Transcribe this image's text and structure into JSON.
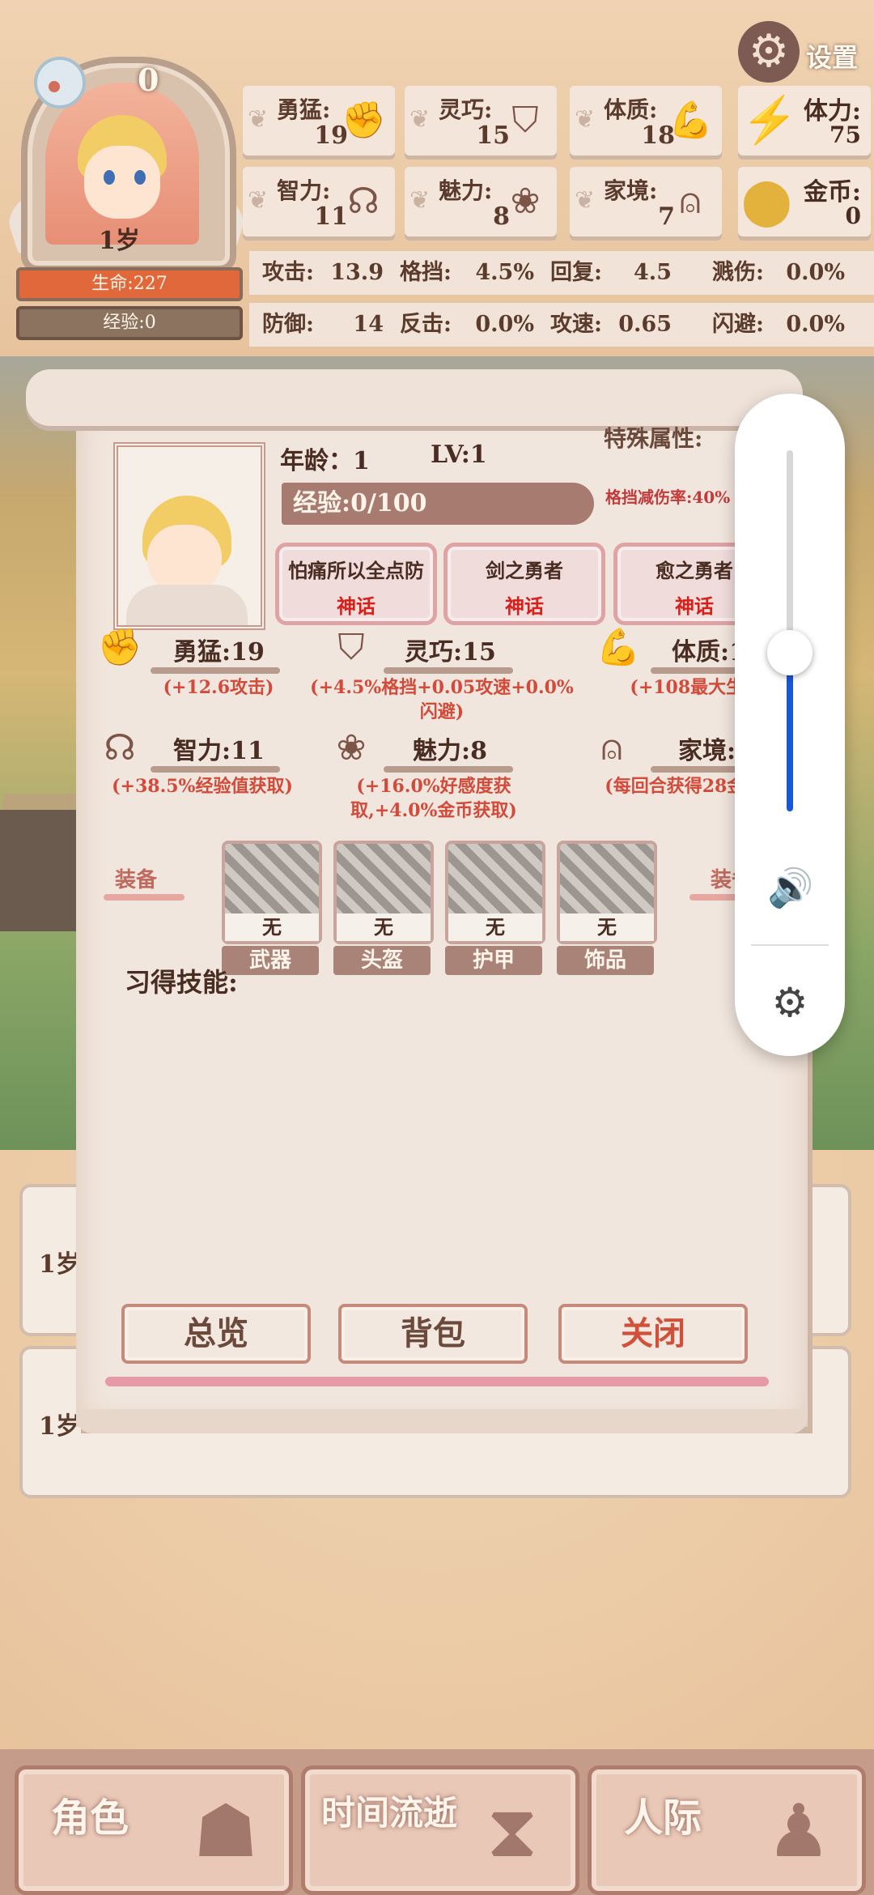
{
  "header": {
    "souls_count": "0",
    "age_badge": "1岁",
    "hp_bar": "生命:227",
    "exp_bar": "经验:0",
    "settings_label": "设置"
  },
  "primary_stats": [
    {
      "label": "勇猛:",
      "value": "19",
      "icon": "fist-icon"
    },
    {
      "label": "灵巧:",
      "value": "15",
      "icon": "cloak-icon"
    },
    {
      "label": "体质:",
      "value": "18",
      "icon": "arm-icon"
    },
    {
      "label": "智力:",
      "value": "11",
      "icon": "brain-icon"
    },
    {
      "label": "魅力:",
      "value": "8",
      "icon": "tulip-icon"
    },
    {
      "label": "家境:",
      "value": "7",
      "icon": "coin-hand-icon"
    }
  ],
  "resources": [
    {
      "label": "体力:",
      "value": "75",
      "icon": "lightning-icon"
    },
    {
      "label": "金币:",
      "value": "0",
      "icon": "gold-coin-icon"
    }
  ],
  "secondary_stats": [
    {
      "label": "攻击:",
      "value": "13.9"
    },
    {
      "label": "格挡:",
      "value": "4.5%"
    },
    {
      "label": "回复:",
      "value": "4.5"
    },
    {
      "label": "溅伤:",
      "value": "0.0%"
    },
    {
      "label": "防御:",
      "value": "14"
    },
    {
      "label": "反击:",
      "value": "0.0%"
    },
    {
      "label": "攻速:",
      "value": "0.65"
    },
    {
      "label": "闪避:",
      "value": "0.0%"
    }
  ],
  "panel": {
    "age_text": "年龄：1",
    "level_text": "LV:1",
    "exp_text": "经验:0/100",
    "special_label": "特殊属性:",
    "special_value": "格挡减伤率:40%",
    "talents": [
      {
        "name": "怕痛所以全点防",
        "rank": "神话"
      },
      {
        "name": "剑之勇者",
        "rank": "神话"
      },
      {
        "name": "愈之勇者",
        "rank": "神话"
      }
    ],
    "attributes": [
      {
        "name": "勇猛:19",
        "desc": "(+12.6攻击)",
        "icon": "fist-icon"
      },
      {
        "name": "灵巧:15",
        "desc": "(+4.5%格挡+0.05攻速+0.0%闪避)",
        "icon": "cloak-icon"
      },
      {
        "name": "体质:18",
        "desc": "(+108最大生命)",
        "icon": "arm-icon"
      },
      {
        "name": "智力:11",
        "desc": "(+38.5%经验值获取)",
        "icon": "brain-icon"
      },
      {
        "name": "魅力:8",
        "desc": "(+16.0%好感度获取,+4.0%金币获取)",
        "icon": "tulip-icon"
      },
      {
        "name": "家境:7",
        "desc": "(每回合获得28金币)",
        "icon": "coin-hand-icon"
      }
    ],
    "equip_label_left": "装备",
    "equip_label_right": "装备",
    "equipment": [
      {
        "status": "无",
        "slot": "武器"
      },
      {
        "status": "无",
        "slot": "头盔"
      },
      {
        "status": "无",
        "slot": "护甲"
      },
      {
        "status": "无",
        "slot": "饰品"
      }
    ],
    "skills_title": "习得技能:",
    "buttons": {
      "overview": "总览",
      "backpack": "背包",
      "close": "关闭"
    }
  },
  "log_cards": [
    {
      "age": "1岁"
    },
    {
      "age": "1岁"
    }
  ],
  "volume_overlay": {
    "level": 0.44
  },
  "bottom_nav": [
    {
      "label": "角色",
      "icon": "head-silhouette-icon"
    },
    {
      "label": "时间流逝",
      "icon": "hourglass-icon"
    },
    {
      "label": "人际",
      "icon": "pawns-icon"
    }
  ]
}
